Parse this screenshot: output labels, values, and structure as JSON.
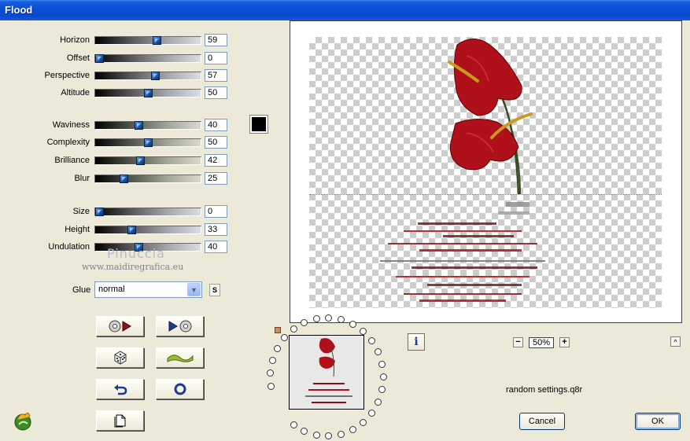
{
  "window": {
    "title": "Flood"
  },
  "sliders": [
    {
      "id": "horizon",
      "label": "Horizon",
      "value": "59",
      "level": 0.59,
      "style": "gray"
    },
    {
      "id": "offset",
      "label": "Offset",
      "value": "0",
      "level": 0.0,
      "style": "gray"
    },
    {
      "id": "perspective",
      "label": "Perspective",
      "value": "57",
      "level": 0.57,
      "style": "gray"
    },
    {
      "id": "altitude",
      "label": "Altitude",
      "value": "50",
      "level": 0.5,
      "style": "gray"
    },
    {
      "id": "waviness",
      "label": "Waviness",
      "value": "40",
      "level": 0.4,
      "style": "olive"
    },
    {
      "id": "complexity",
      "label": "Complexity",
      "value": "50",
      "level": 0.5,
      "style": "olive"
    },
    {
      "id": "brilliance",
      "label": "Brilliance",
      "value": "42",
      "level": 0.42,
      "style": "olive"
    },
    {
      "id": "blur",
      "label": "Blur",
      "value": "25",
      "level": 0.25,
      "style": "olive"
    },
    {
      "id": "size",
      "label": "Size",
      "value": "0",
      "level": 0.0,
      "style": "gray"
    },
    {
      "id": "height",
      "label": "Height",
      "value": "33",
      "level": 0.33,
      "style": "gray"
    },
    {
      "id": "undulation",
      "label": "Undulation",
      "value": "40",
      "level": 0.4,
      "style": "gray"
    }
  ],
  "color_swatch": "#000000",
  "watermark": {
    "name": "Pinuccia",
    "url": "www.maidiregrafica.eu"
  },
  "glue": {
    "label": "Glue",
    "value": "normal",
    "s_button": "S"
  },
  "tool_buttons": [
    {
      "id": "load-preset",
      "icon": "load-preset-icon"
    },
    {
      "id": "save-preset",
      "icon": "save-preset-icon"
    },
    {
      "id": "randomize",
      "icon": "dice-icon"
    },
    {
      "id": "wave",
      "icon": "wave-icon"
    },
    {
      "id": "undo",
      "icon": "undo-arrow-icon"
    },
    {
      "id": "reset",
      "icon": "ring-icon"
    },
    {
      "id": "copy",
      "icon": "document-icon"
    }
  ],
  "zoom": {
    "minus": "−",
    "value": "50%",
    "plus": "+"
  },
  "info_button": "i",
  "collapse_button": "^",
  "random_settings_label": "random settings.q8r",
  "buttons": {
    "cancel": "Cancel",
    "ok": "OK"
  },
  "colors": {
    "titlebar": "#0a4fd6",
    "dialog_bg": "#ece9d8",
    "horizon_line": "#2fb82f",
    "flower_red": "#b0101a"
  }
}
